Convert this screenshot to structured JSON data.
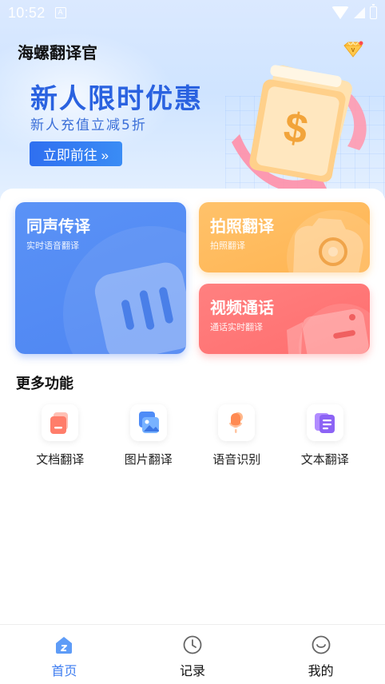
{
  "status_bar": {
    "time": "10:52",
    "notification_icon": "a-icon"
  },
  "header": {
    "app_title": "海螺翻译官",
    "vip_icon": "diamond-crown-icon"
  },
  "banner": {
    "title": "新人限时优惠",
    "subtitle": "新人充值立减5折",
    "button_label": "立即前往 »",
    "illustration": "dollar-coupon-icon"
  },
  "cards": {
    "interpretation": {
      "title": "同声传译",
      "subtitle": "实时语音翻译",
      "icon": "sound-wave-icon"
    },
    "photo": {
      "title": "拍照翻译",
      "subtitle": "拍照翻译",
      "icon": "camera-icon"
    },
    "video_call": {
      "title": "视频通话",
      "subtitle": "通话实时翻译",
      "icon": "video-camera-icon"
    }
  },
  "more": {
    "title": "更多功能",
    "items": [
      {
        "label": "文档翻译",
        "icon": "document-icon"
      },
      {
        "label": "图片翻译",
        "icon": "image-icon"
      },
      {
        "label": "语音识别",
        "icon": "microphone-icon"
      },
      {
        "label": "文本翻译",
        "icon": "text-icon"
      }
    ]
  },
  "tabbar": {
    "items": [
      {
        "label": "首页",
        "icon": "home-icon",
        "active": true
      },
      {
        "label": "记录",
        "icon": "clock-icon",
        "active": false
      },
      {
        "label": "我的",
        "icon": "smiley-icon",
        "active": false
      }
    ]
  },
  "colors": {
    "accent": "#3d7cf0",
    "interp_card": "#5a92f6",
    "photo_card": "#ffb452",
    "video_card": "#ff7070"
  }
}
